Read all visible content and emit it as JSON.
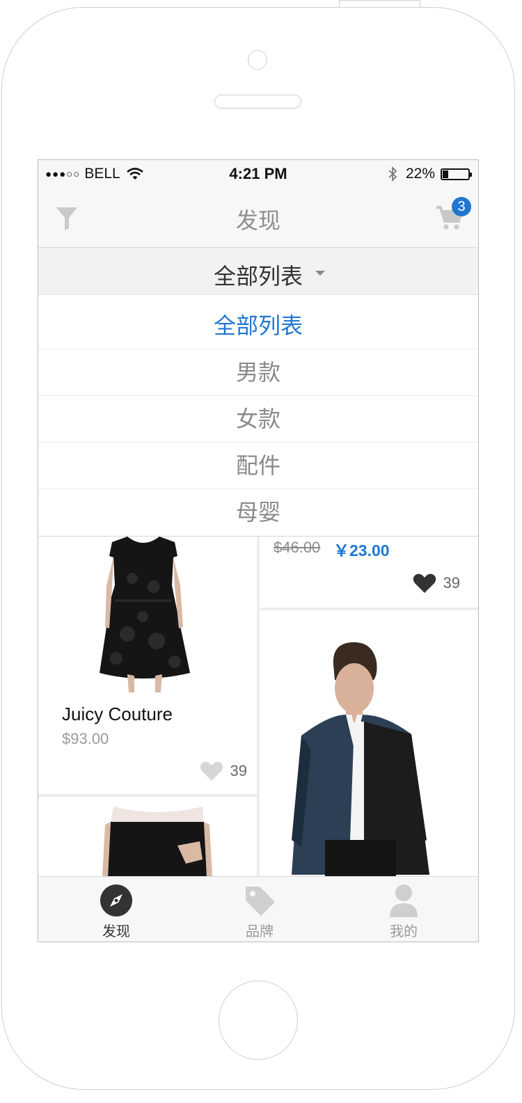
{
  "status": {
    "carrier": "BELL",
    "time": "4:21 PM",
    "battery": "22%"
  },
  "navbar": {
    "title": "发现",
    "cart_count": "3"
  },
  "filter": {
    "selected": "全部列表",
    "options": [
      "全部列表",
      "男款",
      "女款",
      "配件",
      "母婴"
    ]
  },
  "products": {
    "card_a": {
      "brand": "Juicy Couture",
      "price": "$93.00",
      "likes": "39"
    },
    "card_b": {
      "old_price": "$46.00",
      "new_price": "￥23.00",
      "likes": "39"
    }
  },
  "tabs": [
    {
      "label": "发现",
      "icon": "compass-icon",
      "active": true
    },
    {
      "label": "品牌",
      "icon": "tag-icon",
      "active": false
    },
    {
      "label": "我的",
      "icon": "user-icon",
      "active": false
    }
  ],
  "colors": {
    "accent": "#1f77d0",
    "muted": "#8e8e93"
  }
}
